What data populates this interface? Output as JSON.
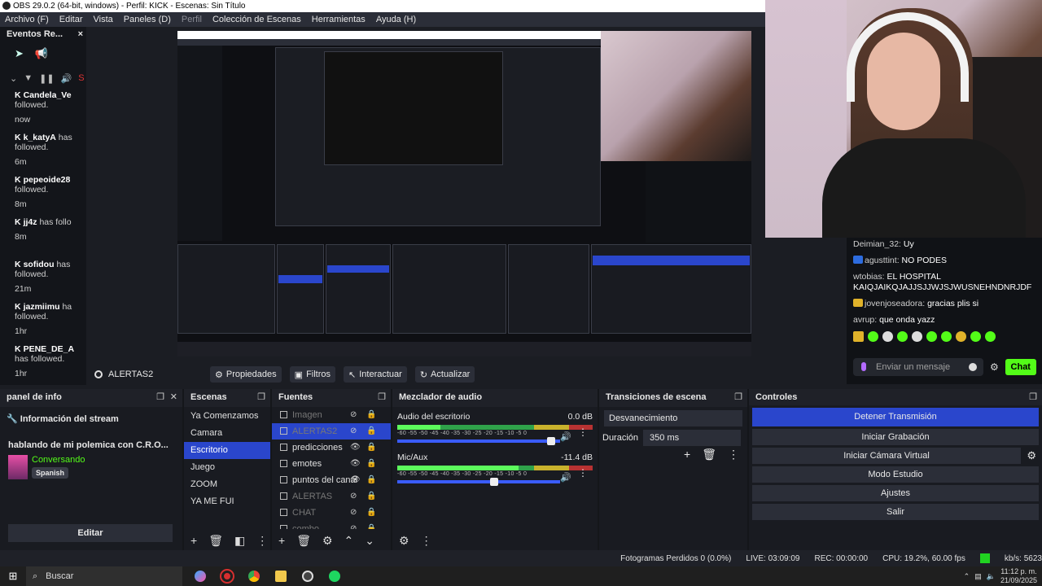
{
  "window": {
    "title": "OBS 29.0.2 (64-bit, windows) - Perfil: KICK - Escenas: Sin Título"
  },
  "menu": [
    {
      "label": "Archivo (F)",
      "dim": false
    },
    {
      "label": "Editar",
      "dim": false
    },
    {
      "label": "Vista",
      "dim": false
    },
    {
      "label": "Paneles (D)",
      "dim": false
    },
    {
      "label": "Perfil",
      "dim": true
    },
    {
      "label": "Colección de Escenas",
      "dim": false
    },
    {
      "label": "Herramientas",
      "dim": false
    },
    {
      "label": "Ayuda (H)",
      "dim": false
    }
  ],
  "events": {
    "title": "Eventos Re...",
    "close": "×",
    "items": [
      {
        "user": "Candela_Ve",
        "msg": "followed.",
        "time": "now"
      },
      {
        "user": "k_katyA",
        "msg": "has followed.",
        "time": "6m"
      },
      {
        "user": "pepeoide28",
        "msg": "followed.",
        "time": "8m"
      },
      {
        "user": "jj4z",
        "msg": "has follo",
        "time": "8m"
      },
      {
        "user": "sofidou",
        "msg": "has followed.",
        "time": "21m"
      },
      {
        "user": "jazmiimu",
        "msg": "ha followed.",
        "time": "1hr"
      },
      {
        "user": "PENE_DE_A",
        "msg": "has followed.",
        "time": "1hr"
      }
    ]
  },
  "kick_chat": {
    "messages": [
      {
        "user": "Deimian_32:",
        "text": "Uy",
        "badge": ""
      },
      {
        "user": "agusttint:",
        "text": "NO PODES",
        "badge": "#2d6cdf"
      },
      {
        "user": "wtobias:",
        "text": "EL HOSPITAL KAIQJAIKQJAJJSJJWJSJWUSNEHNDNRJDF",
        "badge": ""
      },
      {
        "user": "jovenjoseadora:",
        "text": "gracias plis si",
        "badge": "#e0b22a"
      },
      {
        "user": "avrup:",
        "text": "que onda yazz",
        "badge": ""
      }
    ],
    "input_placeholder": "Enviar un mensaje",
    "send_label": "Chat",
    "accent": "#53fc18"
  },
  "source_toolbar": {
    "current": "ALERTAS2",
    "buttons": [
      {
        "icon": "⚙",
        "label": "Propiedades"
      },
      {
        "icon": "▣",
        "label": "Filtros"
      },
      {
        "icon": "↖",
        "label": "Interactuar"
      },
      {
        "icon": "↻",
        "label": "Actualizar"
      }
    ]
  },
  "info_panel": {
    "title": "panel de info",
    "heading": "Información del stream",
    "stream_title": "hablando de mi polemica con C.R.O...",
    "category": "Conversando",
    "language": "Spanish",
    "edit_label": "Editar"
  },
  "scenes": {
    "title": "Escenas",
    "items": [
      {
        "label": "Ya Comenzamos",
        "active": false
      },
      {
        "label": "Camara",
        "active": false
      },
      {
        "label": "Escritorio",
        "active": true
      },
      {
        "label": "Juego",
        "active": false
      },
      {
        "label": "ZOOM",
        "active": false
      },
      {
        "label": "YA ME FUI",
        "active": false
      }
    ]
  },
  "sources": {
    "title": "Fuentes",
    "items": [
      {
        "label": "Imagen",
        "active": false,
        "hidden": true
      },
      {
        "label": "ALERTAS2",
        "active": true,
        "hidden": true
      },
      {
        "label": "predicciones",
        "active": false,
        "hidden": false
      },
      {
        "label": "emotes",
        "active": false,
        "hidden": false
      },
      {
        "label": "puntos del canal",
        "active": false,
        "hidden": false
      },
      {
        "label": "ALERTAS",
        "active": false,
        "hidden": true
      },
      {
        "label": "CHAT",
        "active": false,
        "hidden": true
      },
      {
        "label": "combo",
        "active": false,
        "hidden": true
      }
    ]
  },
  "mixer": {
    "title": "Mezclador de audio",
    "ticks": "-60 -55 -50 -45 -40 -35 -30 -25 -20 -15 -10 -5 0",
    "channels": [
      {
        "name": "Audio del escritorio",
        "db": "0.0 dB",
        "level": 0.22,
        "fader": 0.97
      },
      {
        "name": "Mic/Aux",
        "db": "-11.4 dB",
        "level": 0.62,
        "fader": 0.6
      }
    ]
  },
  "transitions": {
    "title": "Transiciones de escena",
    "selected": "Desvanecimiento",
    "duration_label": "Duración",
    "duration_value": "350 ms"
  },
  "controls": {
    "title": "Controles",
    "buttons": [
      {
        "label": "Detener Transmisión",
        "primary": true
      },
      {
        "label": "Iniciar Grabación",
        "primary": false
      },
      {
        "label": "Iniciar Cámara Virtual",
        "primary": false
      },
      {
        "label": "Modo Estudio",
        "primary": false
      },
      {
        "label": "Ajustes",
        "primary": false
      },
      {
        "label": "Salir",
        "primary": false
      }
    ]
  },
  "status": {
    "dropped": "Fotogramas Perdidos 0 (0.0%)",
    "live": "LIVE: 03:09:09",
    "rec": "REC: 00:00:00",
    "cpu": "CPU: 19.2%, 60.00 fps",
    "kbps": "kb/s: 5623"
  },
  "taskbar": {
    "search": "Buscar",
    "time": "11:12 p. m.",
    "date": "21/09/2025"
  }
}
